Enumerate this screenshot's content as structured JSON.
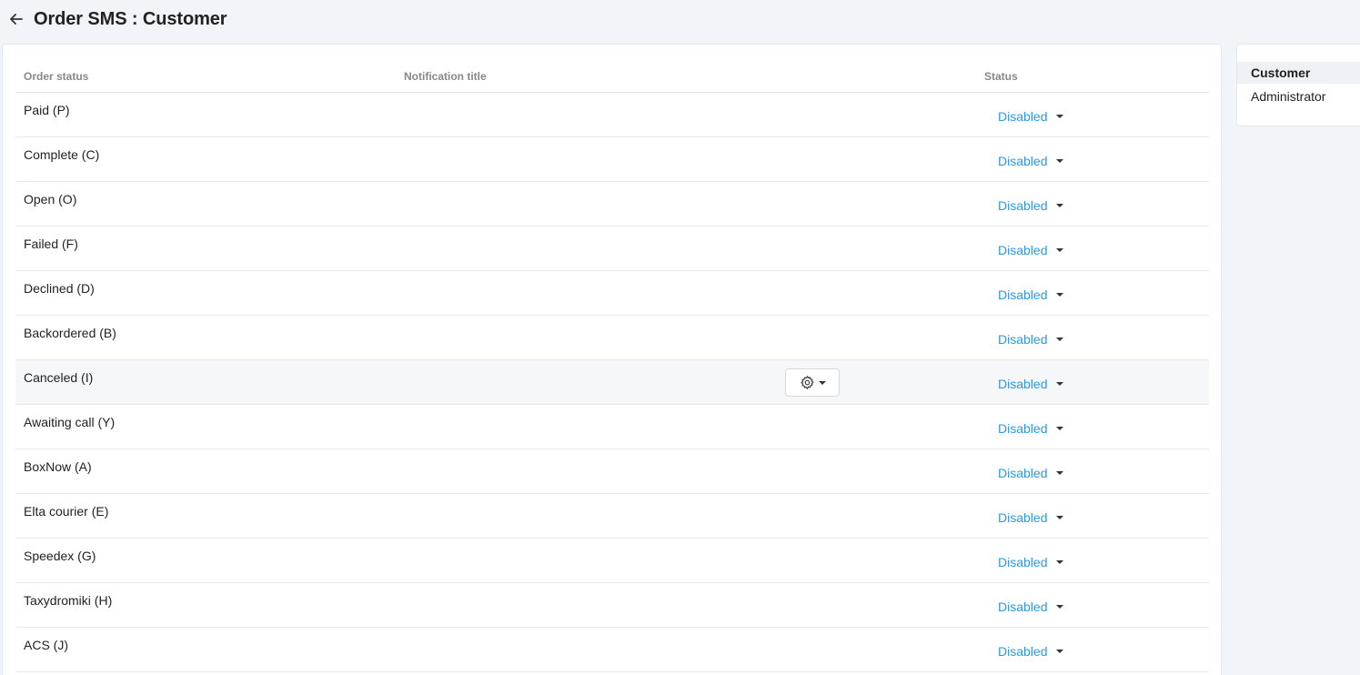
{
  "header": {
    "title": "Order SMS : Customer",
    "back_icon": "arrow-left-icon"
  },
  "table": {
    "columns": {
      "order_status": "Order status",
      "notification_title": "Notification title",
      "status": "Status"
    },
    "rows": [
      {
        "name": "Paid (P)",
        "status": "Disabled"
      },
      {
        "name": "Complete (C)",
        "status": "Disabled"
      },
      {
        "name": "Open (O)",
        "status": "Disabled"
      },
      {
        "name": "Failed (F)",
        "status": "Disabled"
      },
      {
        "name": "Declined (D)",
        "status": "Disabled"
      },
      {
        "name": "Backordered (B)",
        "status": "Disabled"
      },
      {
        "name": "Canceled (I)",
        "status": "Disabled"
      },
      {
        "name": "Awaiting call (Y)",
        "status": "Disabled"
      },
      {
        "name": "BoxNow (A)",
        "status": "Disabled"
      },
      {
        "name": "Elta courier (E)",
        "status": "Disabled"
      },
      {
        "name": "Speedex (G)",
        "status": "Disabled"
      },
      {
        "name": "Taxydromiki (H)",
        "status": "Disabled"
      },
      {
        "name": "ACS (J)",
        "status": "Disabled"
      }
    ]
  },
  "sidebar": {
    "items": [
      {
        "label": "Customer",
        "active": true
      },
      {
        "label": "Administrator",
        "active": false
      }
    ]
  },
  "colors": {
    "status_link": "#2a9ae0",
    "background": "#f1f4f8"
  }
}
